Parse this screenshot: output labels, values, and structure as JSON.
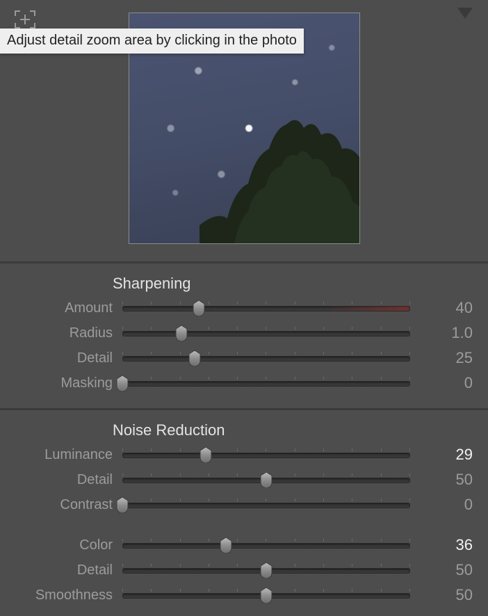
{
  "tooltip": "Adjust detail zoom area by clicking in the photo",
  "sharpening": {
    "title": "Sharpening",
    "sliders": [
      {
        "label": "Amount",
        "value": "40",
        "pos": 26.6,
        "active": false,
        "redTail": true,
        "min": 0,
        "max": 150
      },
      {
        "label": "Radius",
        "value": "1.0",
        "pos": 20.5,
        "active": false,
        "redTail": false,
        "min": 0.5,
        "max": 3.0
      },
      {
        "label": "Detail",
        "value": "25",
        "pos": 25,
        "active": false,
        "redTail": false,
        "min": 0,
        "max": 100
      },
      {
        "label": "Masking",
        "value": "0",
        "pos": 0,
        "active": false,
        "redTail": false,
        "min": 0,
        "max": 100
      }
    ]
  },
  "noise_reduction": {
    "title": "Noise Reduction",
    "group1": [
      {
        "label": "Luminance",
        "value": "29",
        "pos": 29,
        "active": true,
        "min": 0,
        "max": 100
      },
      {
        "label": "Detail",
        "value": "50",
        "pos": 50,
        "active": false,
        "min": 0,
        "max": 100
      },
      {
        "label": "Contrast",
        "value": "0",
        "pos": 0,
        "active": false,
        "min": 0,
        "max": 100
      }
    ],
    "group2": [
      {
        "label": "Color",
        "value": "36",
        "pos": 36,
        "active": true,
        "min": 0,
        "max": 100
      },
      {
        "label": "Detail",
        "value": "50",
        "pos": 50,
        "active": false,
        "min": 0,
        "max": 100
      },
      {
        "label": "Smoothness",
        "value": "50",
        "pos": 50,
        "active": false,
        "min": 0,
        "max": 100
      }
    ]
  }
}
